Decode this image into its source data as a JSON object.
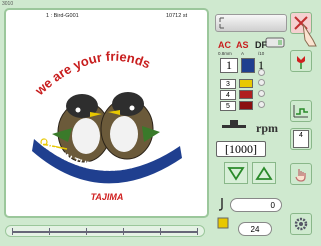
{
  "header": {
    "code": "3010"
  },
  "design": {
    "name": "1 : Bird-G001",
    "stitches": "10712 st",
    "text_top": "we are your friends",
    "text_bottom": "LIVE IN THE FOREST",
    "brand": "TAJIMA"
  },
  "color_panel": {
    "headers": [
      "AC",
      "AS",
      "DF"
    ],
    "subs": [
      "0.8mm",
      "A",
      "/10"
    ],
    "needle_main": "1",
    "df_value": "1",
    "needles": [
      "3",
      "4",
      "5"
    ],
    "needle_colors": [
      "#1f3f8f",
      "#d02020",
      "#e8c800",
      "#b02020",
      "#8b1010"
    ]
  },
  "speed": {
    "unit": "rpm",
    "value": "[1000]"
  },
  "frame_step": {
    "value": "4"
  },
  "counters": {
    "thread": "0",
    "bottom": "24"
  },
  "icons": [
    "close-x-icon",
    "machine-head-icon",
    "hand-cursor-icon",
    "tulip-icon",
    "stitch-chart-icon",
    "frame-icon",
    "hand-icon",
    "gear-icon",
    "thread-spool-icon",
    "down-arrow-icon",
    "up-arrow-icon"
  ]
}
